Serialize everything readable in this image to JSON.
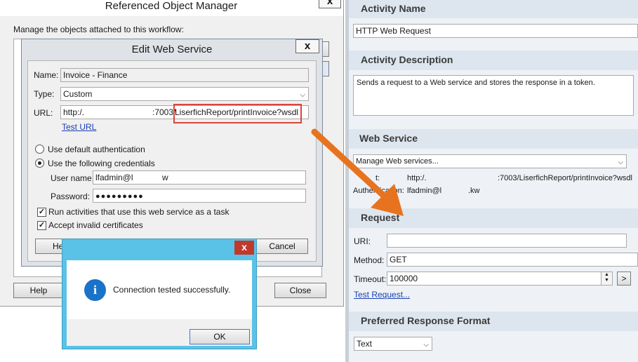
{
  "ref_manager": {
    "title": "Referenced Object Manager",
    "close": "x",
    "description": "Manage the objects attached to this workflow:",
    "help_label": "Help",
    "close_label": "Close"
  },
  "edit_ws": {
    "title": "Edit Web Service",
    "close": "x",
    "name_label": "Name:",
    "name_value": "Invoice - Finance",
    "type_label": "Type:",
    "type_value": "Custom",
    "url_label": "URL:",
    "url_prefix": "http:/.",
    "url_port": ":7003/",
    "url_path": "LiserfichReport/printInvoice?wsdl",
    "test_url": "Test URL",
    "auth_default": "Use default authentication",
    "auth_credentials": "Use the following credentials",
    "username_label": "User name:",
    "username_value": "lfadmin@l",
    "username_suffix": "w",
    "password_label": "Password:",
    "password_value": "●●●●●●●●●",
    "run_as_task": "Run activities that use this web service as a task",
    "accept_invalid": "Accept invalid certificates",
    "help_partial": "He",
    "cancel_label": "Cancel"
  },
  "msgbox": {
    "close": "x",
    "info_glyph": "i",
    "message": "Connection tested successfully.",
    "ok_label": "OK"
  },
  "right_panel": {
    "activity_name_header": "Activity Name",
    "activity_name_value": "HTTP Web Request",
    "activity_desc_header": "Activity Description",
    "activity_desc_value": "Sends a request to a Web service and stores the response in a token.",
    "web_service_header": "Web Service",
    "manage_ws": "Manage Web services...",
    "host_label": "t:",
    "host_value_prefix": "http:/.",
    "host_value_suffix": ":7003/LiserfichReport/printInvoice?wsdl",
    "auth_label": "Authentication:",
    "auth_value_prefix": "lfadmin@l",
    "auth_value_suffix": ".kw",
    "request_header": "Request",
    "uri_label": "URI:",
    "uri_value": "",
    "method_label": "Method:",
    "method_value": "GET",
    "timeout_label": "Timeout:",
    "timeout_value": "100000",
    "next_btn": ">",
    "test_request": "Test Request...",
    "response_format_header": "Preferred Response Format",
    "response_format_value": "Text"
  },
  "colors": {
    "highlight_box": "#d9453a",
    "arrow": "#e8731f",
    "msgbox_titlebar": "#5bc2e7",
    "msgbox_close": "#c0392b",
    "info_icon": "#1a72c9",
    "panel_header": "#dde6ee"
  }
}
